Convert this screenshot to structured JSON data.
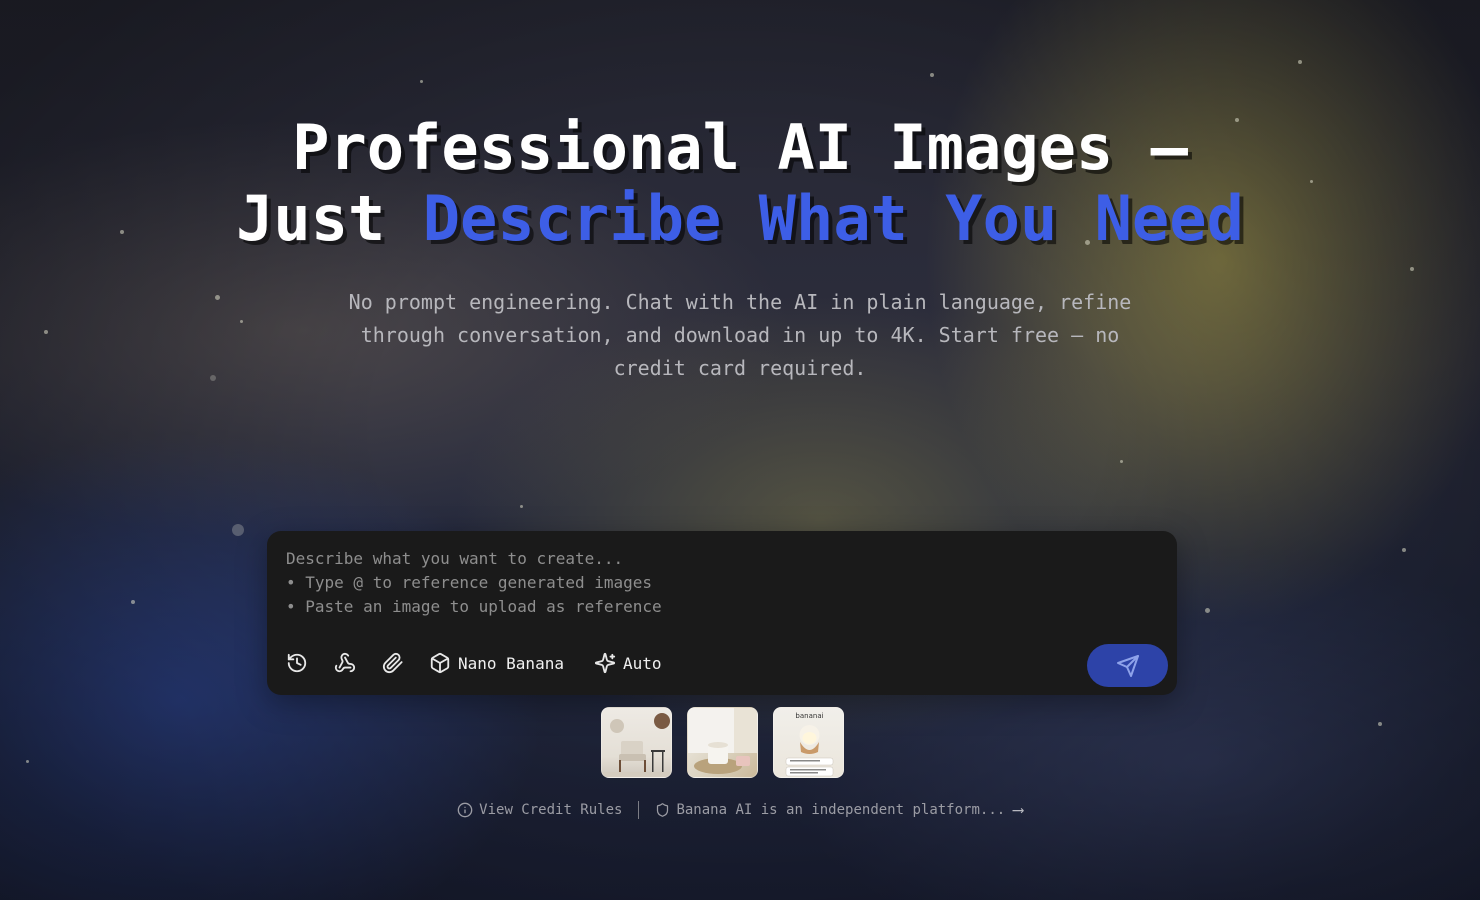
{
  "hero": {
    "title_line1": "Professional AI Images —",
    "title_just": "Just ",
    "title_accent": "Describe What You Need",
    "subtitle": "No prompt engineering. Chat with the AI in plain language, refine through conversation, and download in up to 4K. Start free — no credit card required."
  },
  "composer": {
    "placeholder_lines": [
      "Describe what you want to create...",
      "• Type @ to reference generated images",
      "• Paste an image to upload as reference"
    ],
    "toolbar": {
      "history_icon": "history-icon",
      "style_icon": "webhook-icon",
      "attach_icon": "paperclip-icon",
      "model_label": "Nano Banana",
      "model_icon": "box-icon",
      "mode_label": "Auto",
      "mode_icon": "sparkles-icon"
    },
    "send_icon": "send-icon"
  },
  "examples": [
    {
      "name": "example-thumb-armchair",
      "icon": "image"
    },
    {
      "name": "example-thumb-candle",
      "icon": "image"
    },
    {
      "name": "example-thumb-diffuser",
      "icon": "image",
      "caption": "bananai"
    }
  ],
  "footer": {
    "credit_rules": "View Credit Rules",
    "disclaimer": "Banana AI is an independent platform...",
    "arrow": "⟶"
  },
  "colors": {
    "accent_blue": "#3d5ee6",
    "send_button": "#2d43a8",
    "composer_bg": "#1a1a1a"
  }
}
